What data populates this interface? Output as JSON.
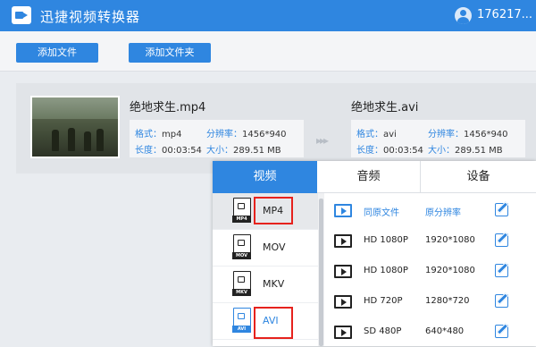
{
  "app": {
    "title": "迅捷视频转换器",
    "user": "176217..."
  },
  "toolbar": {
    "add_file": "添加文件",
    "add_folder": "添加文件夹"
  },
  "task": {
    "source": {
      "name": "绝地求生.mp4",
      "format_label": "格式：",
      "format": "mp4",
      "res_label": "分辨率：",
      "resolution": "1456*940",
      "duration_label": "长度：",
      "duration": "00:03:54",
      "size_label": "大小：",
      "size": "289.51 MB"
    },
    "target": {
      "name": "绝地求生.avi",
      "format_label": "格式：",
      "format": "avi",
      "res_label": "分辨率：",
      "resolution": "1456*940",
      "duration_label": "长度：",
      "duration": "00:03:54",
      "size_label": "大小：",
      "size": "289.51 MB"
    },
    "arrow": "▸▸▸"
  },
  "panel": {
    "tabs": [
      {
        "label": "视频"
      },
      {
        "label": "音频"
      },
      {
        "label": "设备"
      }
    ],
    "formats": [
      {
        "name": "MP4",
        "tag": "MP4"
      },
      {
        "name": "MOV",
        "tag": "MOV"
      },
      {
        "name": "MKV",
        "tag": "MKV"
      },
      {
        "name": "AVI",
        "tag": "AVI"
      }
    ],
    "qualities": [
      {
        "label": "同原文件",
        "res": "原分辨率"
      },
      {
        "label": "HD 1080P",
        "res": "1920*1080"
      },
      {
        "label": "HD 1080P",
        "res": "1920*1080"
      },
      {
        "label": "HD 720P",
        "res": "1280*720"
      },
      {
        "label": "SD 480P",
        "res": "640*480"
      }
    ]
  },
  "colors": {
    "accent": "#2f86e0",
    "highlight_box": "#e6221d"
  }
}
